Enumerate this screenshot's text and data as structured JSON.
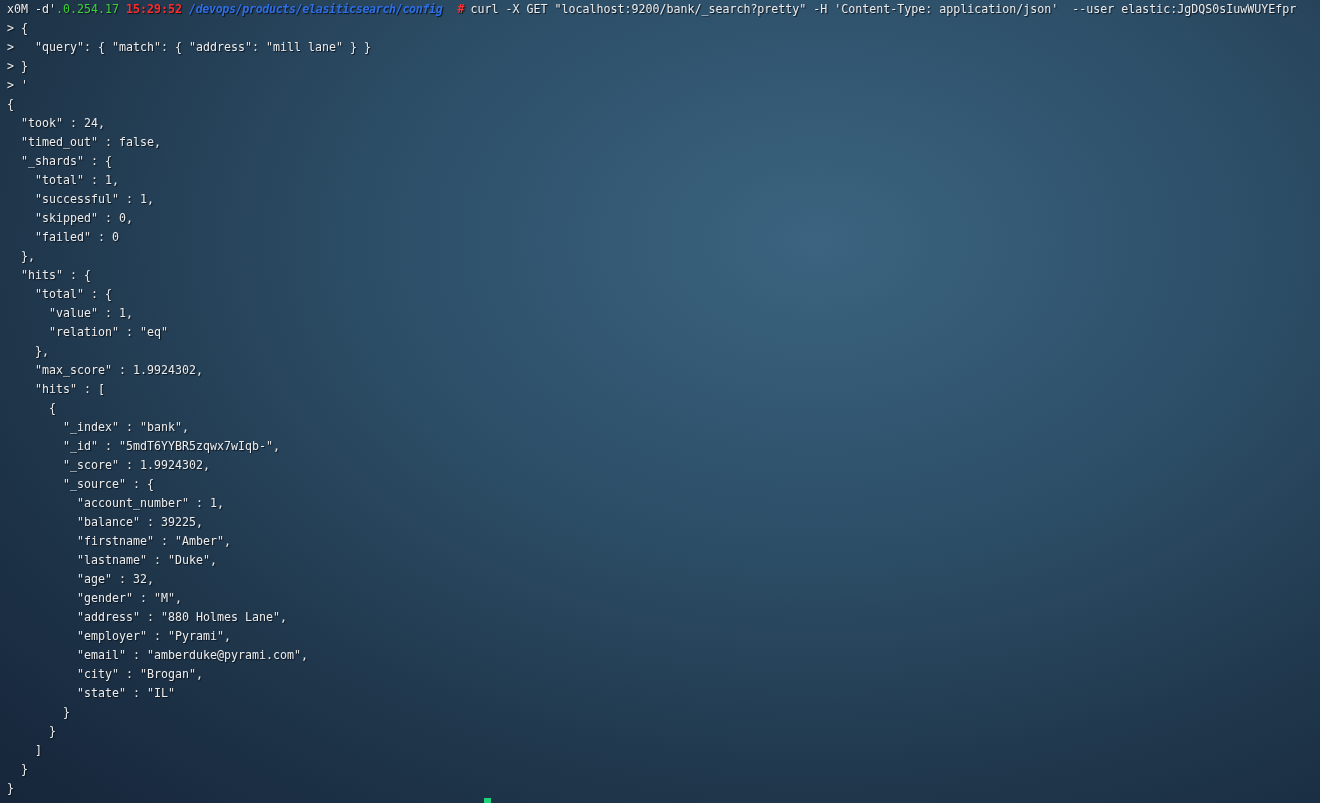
{
  "terminal": {
    "prompt": [
      {
        "kind": "text",
        "text": "x0M -d'"
      },
      {
        "kind": "host",
        "text": ".0.254.17"
      },
      {
        "kind": "time",
        "text": "15:29:52"
      },
      {
        "kind": "path",
        "text": "/devops/products/elasiticsearch/config"
      },
      {
        "kind": "symbol",
        "text": "#"
      },
      {
        "kind": "command",
        "text": "curl -X GET \"localhost:9200/bank/_search?pretty\" -H 'Content-Type: application/json'  --user elastic:JgDQS0sIuwWUYEfpr"
      }
    ],
    "input_lines": [
      "> {",
      ">   \"query\": { \"match\": { \"address\": \"mill lane\" } }",
      "> }",
      "> '"
    ],
    "output": {
      "text": "{",
      "children": [
        {
          "text": "\"took\" : 24,"
        },
        {
          "text": "\"timed_out\" : false,"
        },
        {
          "text": "\"_shards\" : {",
          "children": [
            {
              "text": "\"total\" : 1,"
            },
            {
              "text": "\"successful\" : 1,"
            },
            {
              "text": "\"skipped\" : 0,"
            },
            {
              "text": "\"failed\" : 0"
            }
          ],
          "close": "},"
        },
        {
          "text": "\"hits\" : {",
          "children": [
            {
              "text": "\"total\" : {",
              "children": [
                {
                  "text": "\"value\" : 1,"
                },
                {
                  "text": "\"relation\" : \"eq\""
                }
              ],
              "close": "},"
            },
            {
              "text": "\"max_score\" : 1.9924302,"
            },
            {
              "text": "\"hits\" : [",
              "children": [
                {
                  "text": "{",
                  "children": [
                    {
                      "text": "\"_index\" : \"bank\","
                    },
                    {
                      "text": "\"_id\" : \"5mdT6YYBR5zqwx7wIqb-\","
                    },
                    {
                      "text": "\"_score\" : 1.9924302,"
                    },
                    {
                      "text": "\"_source\" : {",
                      "children": [
                        {
                          "text": "\"account_number\" : 1,"
                        },
                        {
                          "text": "\"balance\" : 39225,"
                        },
                        {
                          "text": "\"firstname\" : \"Amber\","
                        },
                        {
                          "text": "\"lastname\" : \"Duke\","
                        },
                        {
                          "text": "\"age\" : 32,"
                        },
                        {
                          "text": "\"gender\" : \"M\","
                        },
                        {
                          "text": "\"address\" : \"880 Holmes Lane\","
                        },
                        {
                          "text": "\"employer\" : \"Pyrami\","
                        },
                        {
                          "text": "\"email\" : \"amberduke@pyrami.com\","
                        },
                        {
                          "text": "\"city\" : \"Brogan\","
                        },
                        {
                          "text": "\"state\" : \"IL\""
                        }
                      ],
                      "close": "}"
                    }
                  ],
                  "close": "}"
                }
              ],
              "close": "]"
            }
          ],
          "close": "}"
        }
      ],
      "close": "}"
    },
    "cursor": true
  }
}
